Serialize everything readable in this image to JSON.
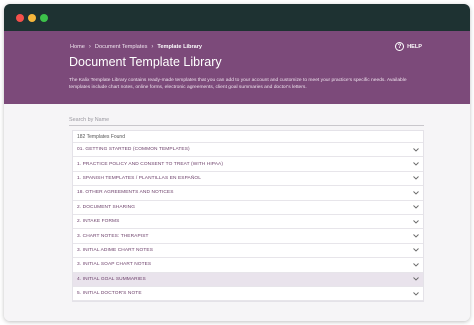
{
  "window": {
    "controls": [
      "close",
      "minimize",
      "maximize"
    ]
  },
  "breadcrumb": {
    "items": [
      "Home",
      "Document Templates",
      "Template Library"
    ],
    "separator": "›"
  },
  "help": {
    "label": "HELP",
    "icon": "?"
  },
  "page": {
    "title": "Document Template Library",
    "description": "The Kalix Template Library contains ready-made templates that you can add to your account and customize to meet your practice's specific needs. Available templates include chart notes, online forms, electronic agreements, client goal summaries and doctor's letters."
  },
  "search": {
    "placeholder": "Search by Name",
    "value": ""
  },
  "templates": {
    "count_label": "182 Templates Found",
    "items": [
      {
        "label": "01. GETTING STARTED (COMMON TEMPLATES)"
      },
      {
        "label": "1. PRACTICE POLICY AND CONSENT TO TREAT (WITH HIPAA)"
      },
      {
        "label": "1. SPANISH TEMPLATES / PLANTILLAS EN ESPAÑOL"
      },
      {
        "label": "18. OTHER AGREEMENTS AND NOTICES"
      },
      {
        "label": "2. DOCUMENT SHARING"
      },
      {
        "label": "2. INTAKE FORMS"
      },
      {
        "label": "3. CHART NOTES: THERAPIST"
      },
      {
        "label": "3. INITIAL ADIME CHART NOTES"
      },
      {
        "label": "3. INITIAL SOAP CHART NOTES"
      },
      {
        "label": "4. INITIAL GOAL SUMMARIES"
      },
      {
        "label": "5. INITIAL DOCTOR'S NOTE"
      }
    ],
    "highlighted_index": 9
  },
  "colors": {
    "header_bg": "#7c4a7a",
    "titlebar_bg": "#1e3232",
    "row_text": "#6a3d68",
    "highlight_bg": "#e9e3ec"
  },
  "icons": {
    "row_toggle": "chevron-down-icon",
    "help": "help-circle-icon"
  }
}
